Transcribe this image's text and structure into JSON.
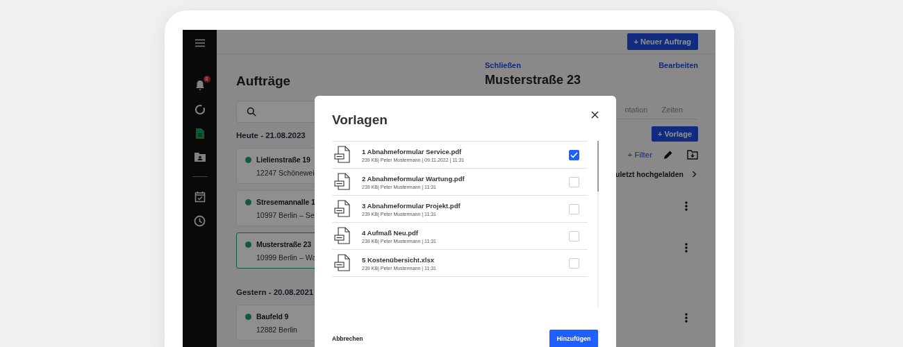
{
  "sidebar": {
    "items": [
      {
        "kind": "notifications",
        "badge": "8",
        "selected": false
      },
      {
        "kind": "progress",
        "selected": false
      },
      {
        "kind": "documents",
        "selected": true
      },
      {
        "kind": "contacts",
        "selected": false
      },
      {
        "kind": "divider"
      },
      {
        "kind": "calendar",
        "selected": false
      },
      {
        "kind": "time",
        "selected": false
      }
    ]
  },
  "header": {
    "new_order_button": "+ Neuer Auftrag"
  },
  "orders": {
    "title": "Aufträge",
    "groups": [
      {
        "heading": "Heute - 21.08.2023",
        "cards": [
          {
            "title": "Lielienstraße 19",
            "subtitle": "12247 Schönewei",
            "selected": false
          },
          {
            "title": "Stresemannalle 1",
            "subtitle": "10997 Berlin – Se",
            "selected": false
          },
          {
            "title": "Musterstraße 23",
            "subtitle": "10999 Berlin – Wa",
            "selected": true
          }
        ]
      },
      {
        "heading": "Gestern - 20.08.2021",
        "cards": [
          {
            "title": "Baufeld 9",
            "subtitle": "12882 Berlin",
            "selected": false
          }
        ]
      }
    ]
  },
  "detail": {
    "close_link": "Schließen",
    "edit_link": "Bearbeiten",
    "title": "Musterstraße 23",
    "tabs": [
      {
        "label": "ntation",
        "selected": false
      },
      {
        "label": "Zeiten",
        "selected": false
      }
    ],
    "template_button": "+ Vorlage",
    "filter_link": "+ Filter",
    "sort_label": "uletzt hochgelalden"
  },
  "modal": {
    "title": "Vorlagen",
    "files": [
      {
        "name": "1 Abnahmeformular Service.pdf",
        "meta": "239 KB| Peter Mustermann |  09.11.2022 | 11:31",
        "checked": true
      },
      {
        "name": "2 Abnahmeformular Wartung.pdf",
        "meta": "239 KB| Peter Mustermann | 11:31",
        "checked": false
      },
      {
        "name": "3 Abnahmeformular Projekt.pdf",
        "meta": "239 KB| Peter Mustermann | 11:31",
        "checked": false
      },
      {
        "name": "4 Aufmaß Neu.pdf",
        "meta": "239 KB| Peter Mustermann | 11:31",
        "checked": false
      },
      {
        "name": "5 Kostenübersicht.xlsx",
        "meta": "239 KB| Peter Mustermann | 11:31",
        "checked": false
      }
    ],
    "cancel_button": "Abbrechen",
    "add_button": "Hinzufügen"
  }
}
